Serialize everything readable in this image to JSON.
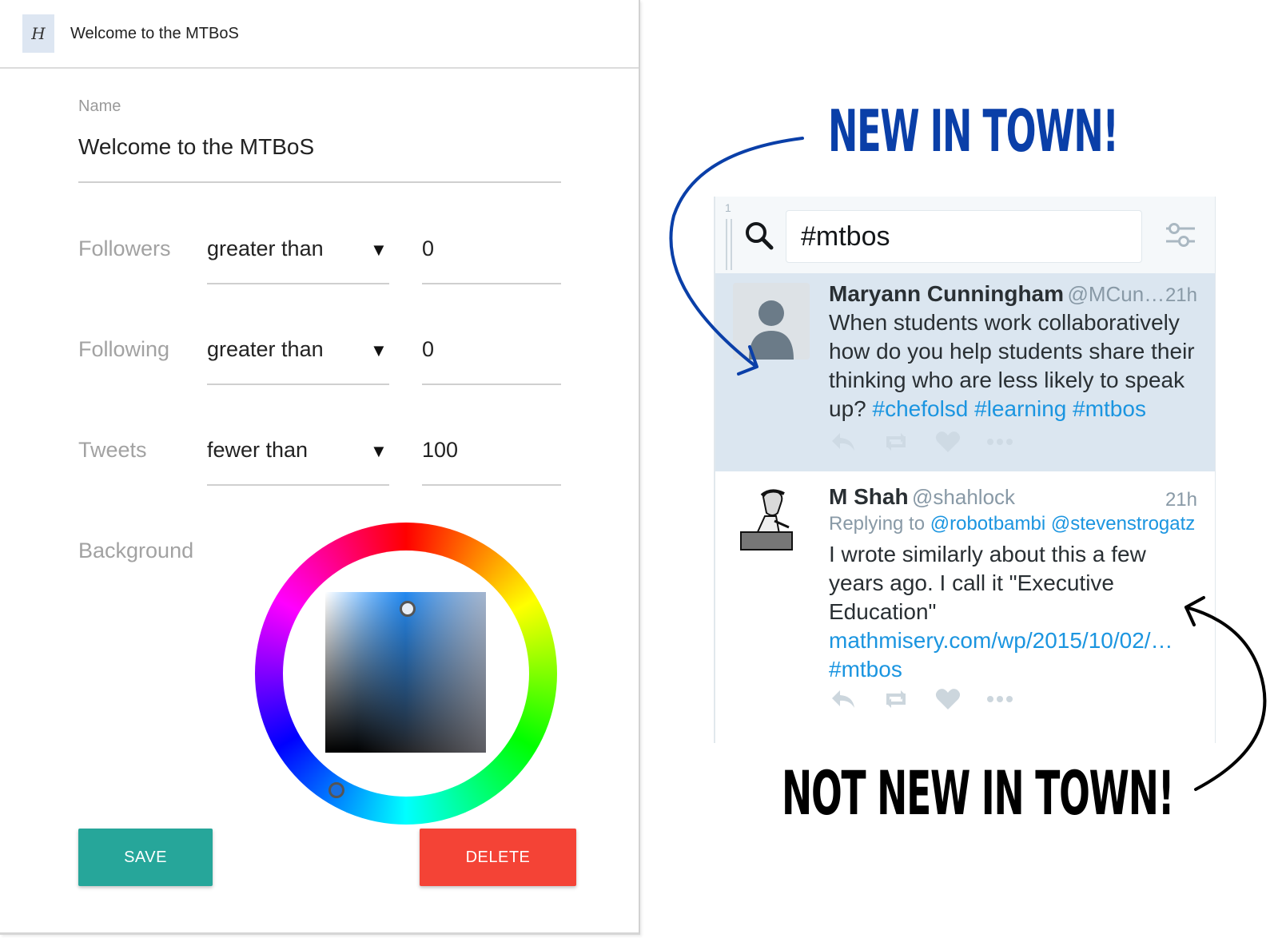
{
  "header": {
    "icon_letter": "H",
    "title": "Welcome to the MTBoS"
  },
  "form": {
    "name_label": "Name",
    "name_value": "Welcome to the MTBoS",
    "rows": [
      {
        "label": "Followers",
        "comparator": "greater than",
        "value": "0"
      },
      {
        "label": "Following",
        "comparator": "greater than",
        "value": "0"
      },
      {
        "label": "Tweets",
        "comparator": "fewer than",
        "value": "100"
      }
    ],
    "select_arrow": "▼",
    "background_label": "Background",
    "save_label": "SAVE",
    "delete_label": "DELETE",
    "save_color": "#26a69a",
    "delete_color": "#f44336"
  },
  "column": {
    "number": "1",
    "search_value": "#mtbos",
    "tweets": [
      {
        "name": "Maryann Cunningham",
        "handle": "@MCun…",
        "time": "21h",
        "text": "When students work collaboratively how do you help students share their thinking who are less likely to speak up?",
        "hashtags": "#chefolsd #learning #mtbos",
        "highlighted": true
      },
      {
        "name": "M Shah",
        "handle": "@shahlock",
        "time": "21h",
        "replying_prefix": "Replying to",
        "replying_to": "@robotbambi @stevenstrogatz",
        "text": "I wrote similarly about this a few years ago. I call it \"Executive Education\"",
        "link": "mathmisery.com/wp/2015/10/02/…",
        "hashtags": "#mtbos",
        "highlighted": false
      }
    ]
  },
  "annotations": {
    "new": "NEW IN TOWN!",
    "not_new": "NOT NEW IN TOWN!",
    "new_color": "#0a3fa8",
    "not_new_color": "#000000"
  }
}
